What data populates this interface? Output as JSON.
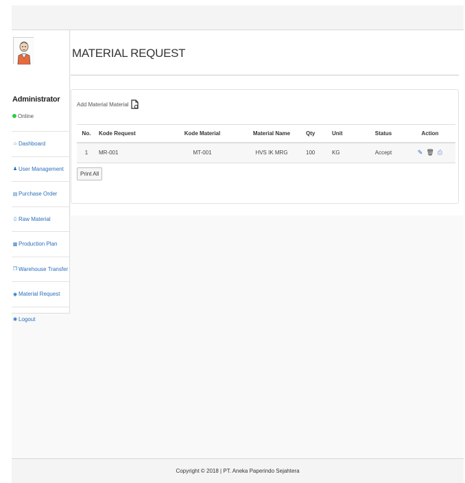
{
  "user": {
    "name": "Administrator",
    "status": "Online"
  },
  "sidebar": {
    "items": [
      {
        "icon": "home-icon",
        "glyph": "⌂",
        "label": "Dashboard"
      },
      {
        "icon": "user-icon",
        "glyph": "♟",
        "label": "User Management"
      },
      {
        "icon": "list-icon",
        "glyph": "▤",
        "label": "Purchase Order"
      },
      {
        "icon": "box-icon",
        "glyph": "▯",
        "label": "Raw Material"
      },
      {
        "icon": "calendar-icon",
        "glyph": "▦",
        "label": "Production Plan"
      },
      {
        "icon": "copy-icon",
        "glyph": "❐",
        "label": "Warehouse Transfer"
      },
      {
        "icon": "circle-icon",
        "glyph": "◉",
        "label": "Material Request"
      },
      {
        "icon": "logout-icon",
        "glyph": "◉",
        "label": "Logout"
      }
    ]
  },
  "page": {
    "title": "MATERIAL REQUEST",
    "add_label": "Add Material Material",
    "print_all": "Print All"
  },
  "table": {
    "headers": [
      "No.",
      "Kode Request",
      "Kode Material",
      "Material Name",
      "Qty",
      "Unit",
      "Status",
      "Action"
    ],
    "rows": [
      {
        "no": "1",
        "kode_request": "MR-001",
        "kode_material": "MT-001",
        "material_name": "HVS IK MRG",
        "qty": "100",
        "unit": "KG",
        "status": "Accept"
      }
    ]
  },
  "footer": {
    "text": "Copyright © 2018 | PT. Aneka Paperindo Sejahtera"
  },
  "colors": {
    "link": "#2a6ebb",
    "online": "#2ecc40"
  }
}
